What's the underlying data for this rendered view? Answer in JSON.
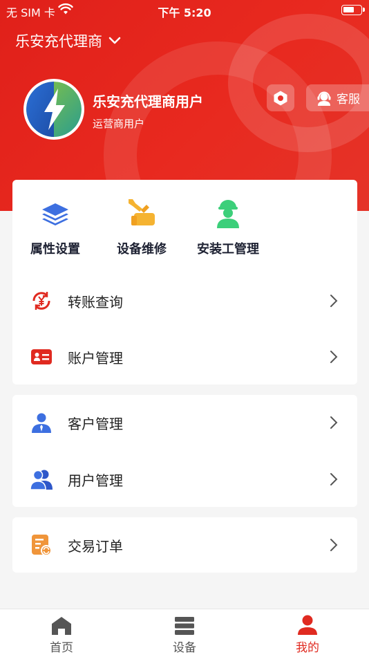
{
  "status_bar": {
    "carrier": "无 SIM 卡",
    "time": "下午 5:20"
  },
  "header": {
    "title": "乐安充代理商",
    "title_icon": "chevron-down-icon",
    "user_name": "乐安充代理商用户",
    "user_role": "运营商用户",
    "settings_icon": "settings-hex-icon",
    "service_label": "客服",
    "service_icon": "headset-agent-icon"
  },
  "quick_actions": [
    {
      "label": "属性设置",
      "icon": "layers-icon",
      "color": "#3d6fe0"
    },
    {
      "label": "设备维修",
      "icon": "repair-wrench-icon",
      "color": "#f5b331"
    },
    {
      "label": "安装工管理",
      "icon": "worker-icon",
      "color": "#3ccf7a"
    }
  ],
  "menu_groups": [
    [
      {
        "label": "转账查询",
        "icon": "yuan-transfer-icon"
      },
      {
        "label": "账户管理",
        "icon": "id-card-icon"
      }
    ],
    [
      {
        "label": "客户管理",
        "icon": "customer-icon"
      },
      {
        "label": "用户管理",
        "icon": "users-icon"
      }
    ],
    [
      {
        "label": "交易订单",
        "icon": "order-list-icon"
      }
    ]
  ],
  "tabbar": {
    "items": [
      {
        "label": "首页",
        "icon": "home-icon"
      },
      {
        "label": "设备",
        "icon": "server-icon"
      },
      {
        "label": "我的",
        "icon": "profile-icon"
      }
    ],
    "active_index": 2
  },
  "colors": {
    "brand_red": "#e3231c",
    "active_tab": "#e02a20",
    "icon_blue": "#3d6fe0",
    "icon_red": "#e02a20",
    "icon_orange": "#f0953a"
  }
}
